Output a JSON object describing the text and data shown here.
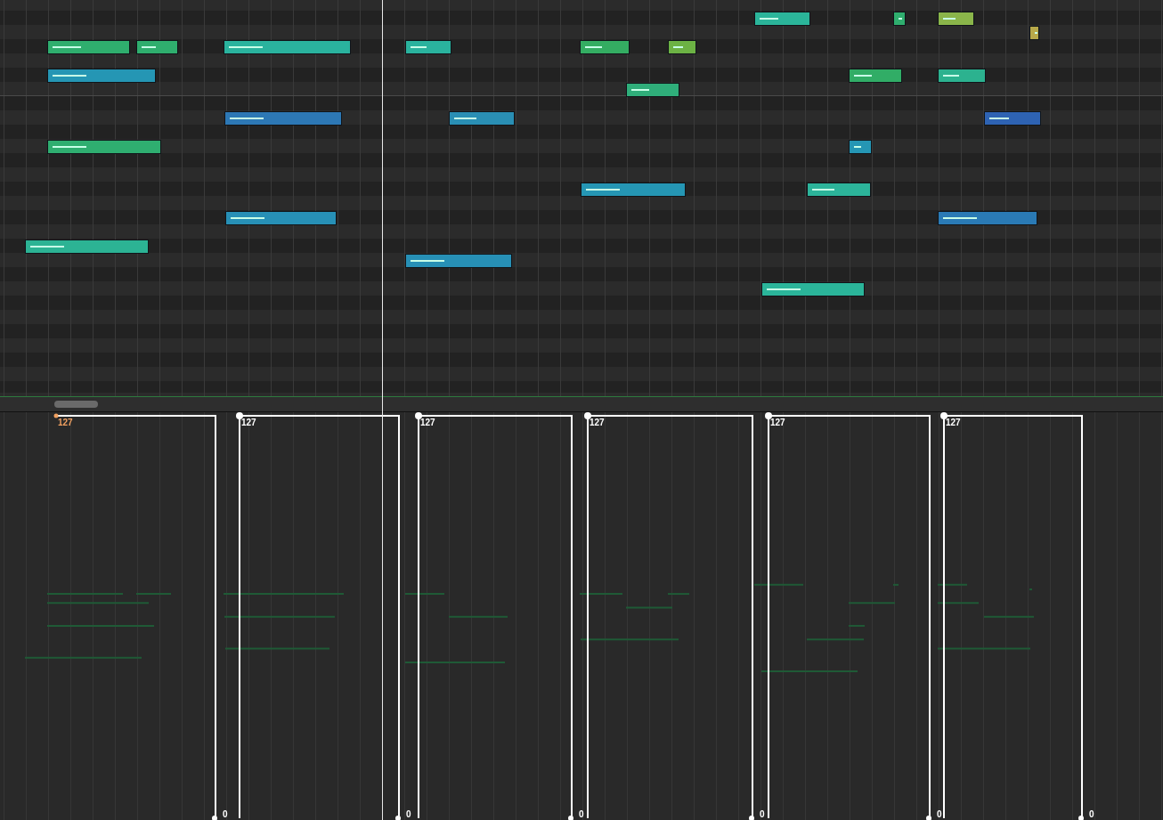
{
  "piano_roll": {
    "notes": [
      {
        "color": "#2bb59a"
      },
      {
        "color": "#2fae6e"
      },
      {
        "color": "#8ab54a"
      },
      {
        "color": "#b8a94a"
      },
      {
        "color": "#2fae6e"
      },
      {
        "color": "#2fae6e"
      },
      {
        "color": "#2ab39e"
      },
      {
        "color": "#2ab39e"
      },
      {
        "color": "#34ad62"
      },
      {
        "color": "#6cb244"
      },
      {
        "color": "#2596b4"
      },
      {
        "color": "#31ad66"
      },
      {
        "color": "#2cb28f"
      },
      {
        "color": "#2fae7a"
      },
      {
        "color": "#2d78b5"
      },
      {
        "color": "#2a8fb4"
      },
      {
        "color": "#2e63b3"
      },
      {
        "color": "#2fae70"
      },
      {
        "color": "#2596b4"
      },
      {
        "color": "#2596b4"
      },
      {
        "color": "#2cb49a"
      },
      {
        "color": "#2790b6"
      },
      {
        "color": "#2a7ab5"
      },
      {
        "color": "#2cb394"
      },
      {
        "color": "#2790b6"
      },
      {
        "color": "#2bb59a"
      }
    ]
  },
  "velocity_lane": {
    "envelopes": [
      {
        "top_label": "127",
        "bottom_label": "0",
        "selected": true
      },
      {
        "top_label": "127",
        "bottom_label": "0",
        "selected": false
      },
      {
        "top_label": "127",
        "bottom_label": "0",
        "selected": false
      },
      {
        "top_label": "127",
        "bottom_label": "0",
        "selected": false
      },
      {
        "top_label": "127",
        "bottom_label": "0",
        "selected": false
      },
      {
        "top_label": "127",
        "bottom_label": "0",
        "selected": false
      }
    ]
  }
}
